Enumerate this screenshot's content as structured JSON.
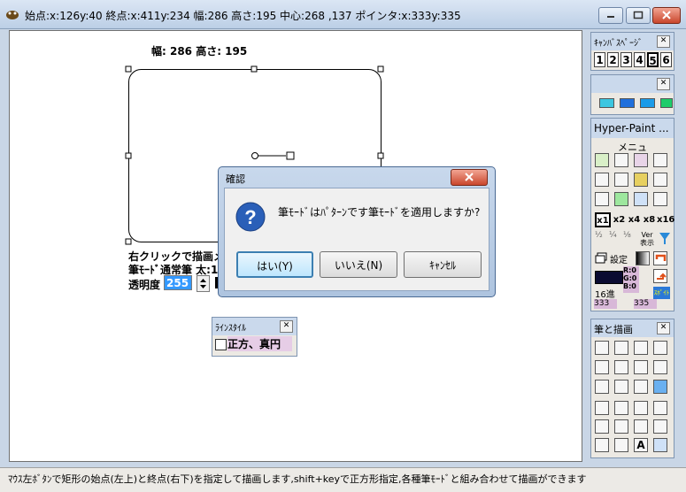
{
  "window": {
    "title": "始点:x:126y:40 終点:x:411y:234 幅:286 高さ:195 中心:268 ,137 ポインタ:x:333y:335"
  },
  "canvas": {
    "size_label": "幅: 286  高さ: 195",
    "info_line1": "右クリックで描画メ",
    "info_line2": "筆ﾓｰﾄﾞ通常筆 太:1",
    "opacity_label": "透明度",
    "opacity_value": "255"
  },
  "linestyle": {
    "title": "ﾗｲﾝｽﾀｲﾙ",
    "checkbox_label": "正方、真円"
  },
  "dialog": {
    "title": "確認",
    "message": "筆ﾓｰﾄﾞはﾊﾟﾀｰﾝです筆ﾓｰﾄﾞを適用しますか?",
    "yes": "はい(Y)",
    "no": "いいえ(N)",
    "cancel": "ｷｬﾝｾﾙ"
  },
  "canvas_pages": {
    "title": "ｷｬﾝﾊﾞｽﾍﾟｰｼﾞ",
    "pages": [
      "1",
      "2",
      "3",
      "4",
      "5",
      "6"
    ]
  },
  "hyperpaint": {
    "title": "Hyper-Paint ...",
    "menu_label": "メニュ",
    "mag": [
      "x1",
      "x2",
      "x4",
      "x8",
      "x16"
    ],
    "ver_label": "Ver\n表示",
    "settings_label": "設定",
    "rgb": [
      "R:0",
      "G:0",
      "B:0"
    ],
    "hex_label": "16進",
    "coord_left": "333",
    "coord_right": "335",
    "spoit_label": "ｽﾎﾟｲﾄ"
  },
  "pen_palette": {
    "title": "筆と描画"
  },
  "status": {
    "text": "ﾏｳｽ左ﾎﾞﾀﾝで矩形の始点(左上)と終点(右下)を指定して描画します,shift+keyで正方形指定,各種筆ﾓｰﾄﾞと組み合わせて描画ができます"
  },
  "colors": {
    "selection": "#3399ff",
    "question_icon": "#2a5fb8"
  }
}
